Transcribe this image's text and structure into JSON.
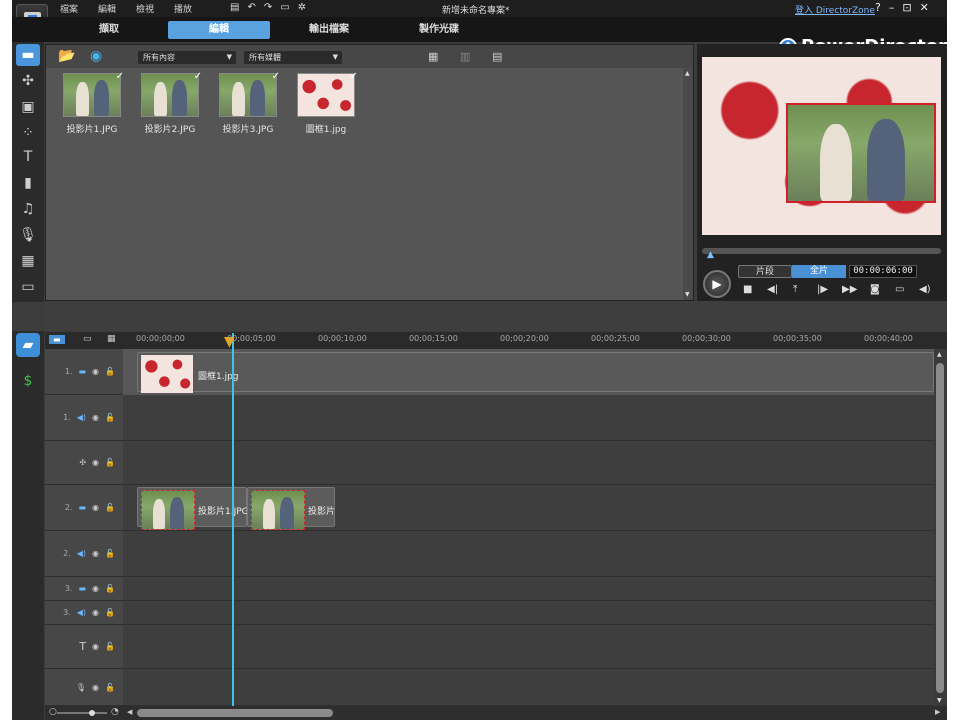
{
  "titlebar": {
    "menu": [
      "檔案",
      "編輯",
      "檢視",
      "播放"
    ],
    "project_title": "新增未命名專案*",
    "login_link": "登入 DirectorZone",
    "window_controls": [
      "?",
      "–",
      "⊡",
      "✕"
    ]
  },
  "tabs": [
    {
      "label": "擷取",
      "active": false
    },
    {
      "label": "編輯",
      "active": true
    },
    {
      "label": "輸出檔案",
      "active": false
    },
    {
      "label": "製作光碟",
      "active": false
    }
  ],
  "brand": {
    "name": "PowerDirector"
  },
  "library": {
    "filter_content": "所有內容",
    "filter_media": "所有媒體",
    "items": [
      {
        "label": "投影片1.JPG",
        "type": "couple",
        "checked": true
      },
      {
        "label": "投影片2.JPG",
        "type": "couple",
        "checked": true
      },
      {
        "label": "投影片3.JPG",
        "type": "couple",
        "checked": true
      },
      {
        "label": "圖框1.jpg",
        "type": "hearts",
        "checked": true
      }
    ]
  },
  "preview": {
    "mode_clip": "片段",
    "mode_full": "全片",
    "timecode": "00:00:06:00"
  },
  "timeline": {
    "ruler_ticks": [
      "00;00;00;00",
      "00;00;05;00",
      "00;00;10;00",
      "00;00;15;00",
      "00;00;20;00",
      "00;00;25;00",
      "00;00;30;00",
      "00;00;35;00",
      "00;00;40;00"
    ],
    "tracks": [
      {
        "num": "1.",
        "kind": "video"
      },
      {
        "num": "1.",
        "kind": "audio"
      },
      {
        "num": "",
        "kind": "effect"
      },
      {
        "num": "2.",
        "kind": "video"
      },
      {
        "num": "2.",
        "kind": "audio"
      },
      {
        "num": "3.",
        "kind": "video"
      },
      {
        "num": "3.",
        "kind": "audio"
      },
      {
        "num": "",
        "kind": "title"
      },
      {
        "num": "",
        "kind": "voice"
      }
    ],
    "clips": {
      "track1_label": "圖框1.jpg",
      "track2_clip1_label": "投影片1.JPG",
      "track2_clip2_label": "投影片"
    }
  }
}
